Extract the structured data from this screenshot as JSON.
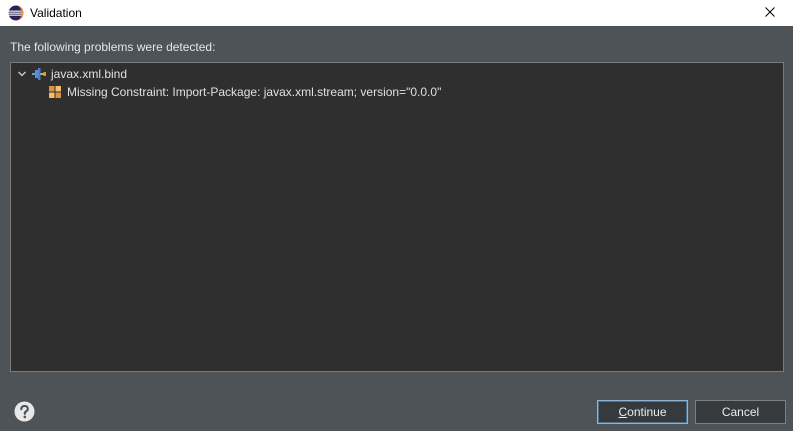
{
  "window": {
    "title": "Validation",
    "app_icon": "eclipse-icon",
    "close_icon": "close-icon"
  },
  "prompt": "The following problems were detected:",
  "tree": {
    "root": {
      "label": "javax.xml.bind",
      "expanded": true,
      "icon": "plugin-icon",
      "children": [
        {
          "label": "Missing Constraint: Import-Package: javax.xml.stream; version=\"0.0.0\"",
          "icon": "constraint-error-icon"
        }
      ]
    }
  },
  "buttons": {
    "help_icon": "help-icon",
    "continue_label": "Continue",
    "cancel_label": "Cancel"
  },
  "colors": {
    "background": "#4d5356",
    "tree_background": "#2f2f2f",
    "text": "#e6e6e6",
    "default_button_border": "#8fb6d6"
  }
}
